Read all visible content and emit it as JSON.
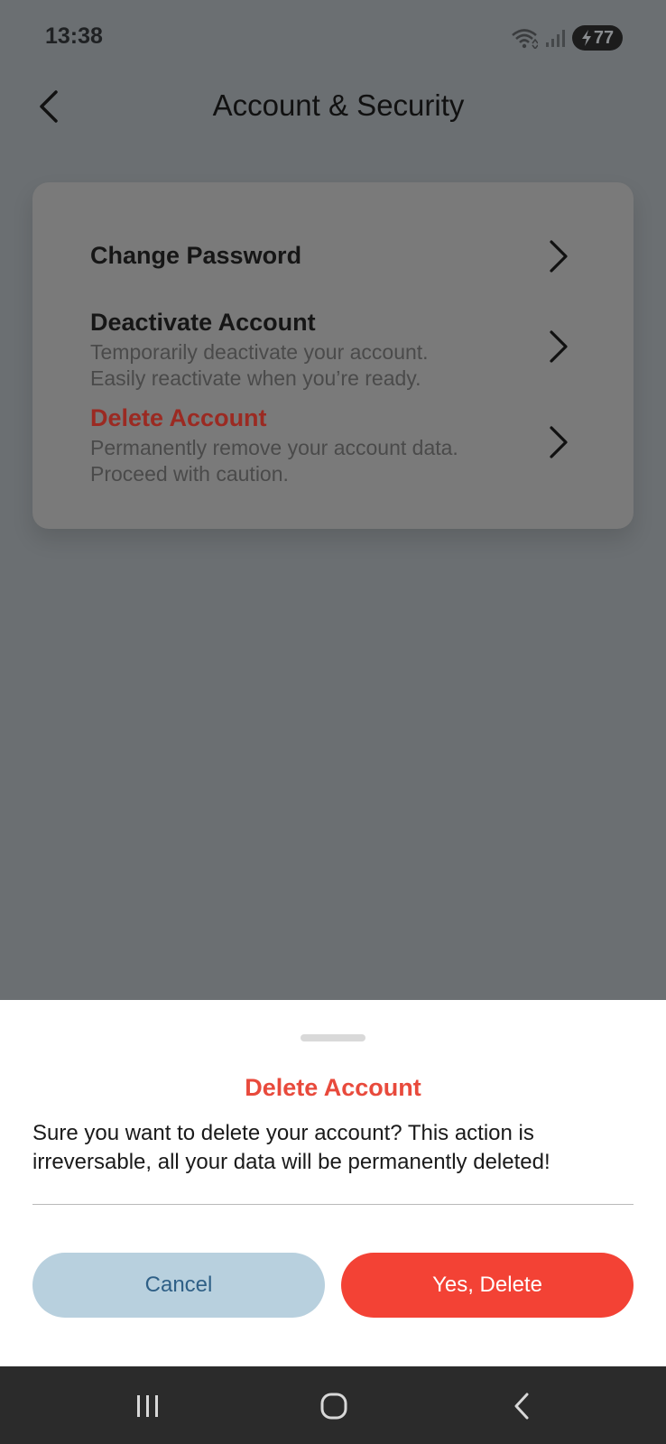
{
  "status_bar": {
    "time": "13:38",
    "battery_level": "77",
    "icons": [
      "wifi-icon",
      "signal-icon",
      "battery-icon",
      "charging-icon"
    ]
  },
  "header": {
    "title": "Account & Security",
    "back_icon": "back-arrow-icon"
  },
  "menu": {
    "items": [
      {
        "title": "Change Password",
        "description": "",
        "style": "normal"
      },
      {
        "title": "Deactivate Account",
        "description_line1": "Temporarily deactivate your account.",
        "description_line2": "Easily reactivate when you’re ready.",
        "style": "normal"
      },
      {
        "title": "Delete Account",
        "description_line1": "Permanently remove your account data.",
        "description_line2": "Proceed with caution.",
        "style": "danger"
      }
    ]
  },
  "dialog": {
    "title": "Delete Account",
    "message": "Sure you want to delete your account? This action is irreversable, all your data will be permanently deleted!",
    "cancel_label": "Cancel",
    "confirm_label": "Yes, Delete"
  },
  "colors": {
    "overlay_background": "#6b6f72",
    "danger_text": "#e84a3c",
    "confirm_button": "#f34235",
    "cancel_button": "#b8d0de",
    "cancel_text": "#2e5f86"
  },
  "nav_bar": {
    "icons": [
      "recent-apps-icon",
      "home-icon",
      "back-icon"
    ]
  }
}
